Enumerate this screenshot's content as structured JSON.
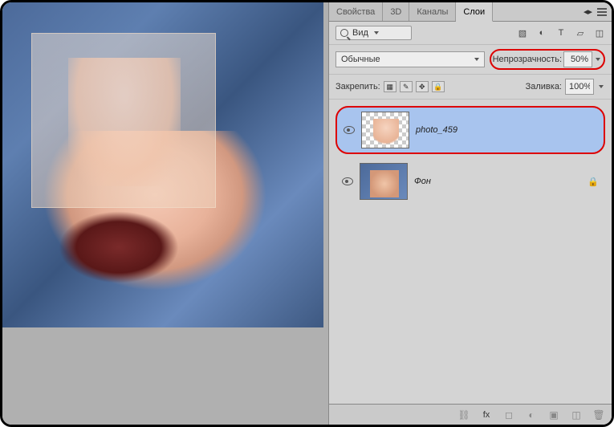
{
  "tabs": {
    "t0": "Свойства",
    "t1": "3D",
    "t2": "Каналы",
    "t3": "Слои"
  },
  "search": {
    "label": "Вид"
  },
  "blend": {
    "selected": "Обычные"
  },
  "opacity": {
    "label": "Непрозрачность:",
    "value": "50%"
  },
  "lock": {
    "label": "Закрепить:"
  },
  "fill": {
    "label": "Заливка:",
    "value": "100%"
  },
  "layers": {
    "l0": "photo_459",
    "l1": "Фон"
  },
  "footer": {
    "fx": "fx"
  }
}
